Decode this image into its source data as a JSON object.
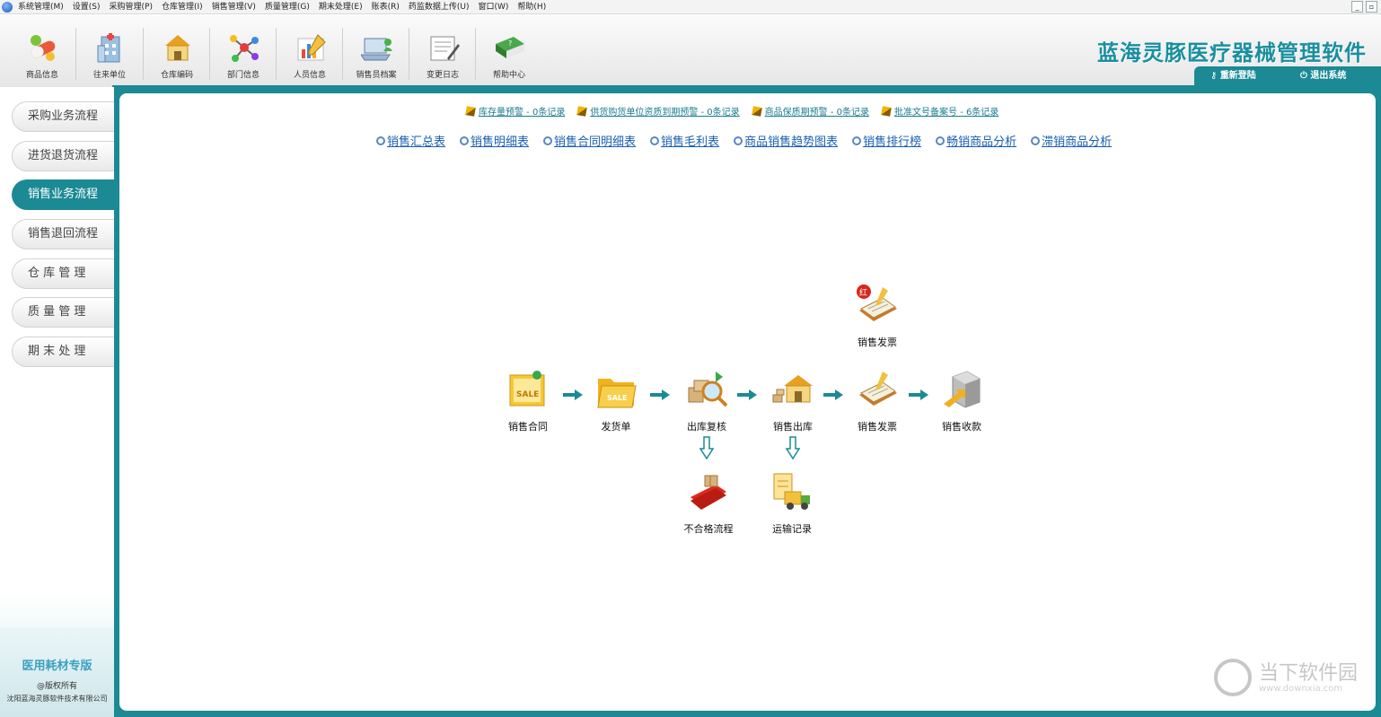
{
  "menu": {
    "items": [
      "系统管理(M)",
      "设置(S)",
      "采购管理(P)",
      "仓库管理(I)",
      "销售管理(V)",
      "质量管理(G)",
      "期末处理(E)",
      "账表(R)",
      "药监数据上传(U)",
      "窗口(W)",
      "帮助(H)"
    ]
  },
  "toolbar": {
    "buttons": [
      {
        "label": "商品信息",
        "icon": "pills-icon"
      },
      {
        "label": "往来单位",
        "icon": "building-icon"
      },
      {
        "label": "仓库编码",
        "icon": "warehouse-icon"
      },
      {
        "label": "部门信息",
        "icon": "network-icon"
      },
      {
        "label": "人员信息",
        "icon": "chart-icon"
      },
      {
        "label": "销售员档案",
        "icon": "laptop-icon"
      },
      {
        "label": "变更日志",
        "icon": "notepad-icon"
      },
      {
        "label": "帮助中心",
        "icon": "help-book-icon"
      }
    ]
  },
  "header": {
    "app_title": "蓝海灵豚医疗器械管理软件",
    "relogin": "重新登陆",
    "exit": "退出系统"
  },
  "sidebar": {
    "items": [
      {
        "label": "采购业务流程",
        "active": false
      },
      {
        "label": "进货退货流程",
        "active": false
      },
      {
        "label": "销售业务流程",
        "active": true
      },
      {
        "label": "销售退回流程",
        "active": false
      },
      {
        "label": "仓 库 管 理",
        "active": false
      },
      {
        "label": "质 量 管 理",
        "active": false
      },
      {
        "label": "期 末 处 理",
        "active": false
      }
    ],
    "edition": "医用耗材专版",
    "copyright": "@版权所有",
    "company": "沈阳蓝海灵豚软件技术有限公司"
  },
  "alerts": [
    "库存量预警 - 0条记录",
    "供货购货单位资质到期预警 - 0条记录",
    "商品保质期预警 - 0条记录",
    "批准文号备案号 - 6条记录"
  ],
  "reports": [
    "销售汇总表",
    "销售明细表",
    "销售合同明细表",
    "销售毛利表",
    "商品销售趋势图表",
    "销售排行榜",
    "畅销商品分析",
    "滞销商品分析"
  ],
  "flow": {
    "top_invoice": {
      "label": "销售发票",
      "badge": "红"
    },
    "main": [
      "销售合同",
      "发货单",
      "出库复核",
      "销售出库",
      "销售发票",
      "销售收款"
    ],
    "sub": [
      "不合格流程",
      "运输记录"
    ]
  },
  "watermark": {
    "text": "当下软件园",
    "url": "www.downxia.com"
  },
  "colors": {
    "accent": "#1b8a94",
    "link": "#1a5fb0",
    "title": "#1a8fa0"
  }
}
